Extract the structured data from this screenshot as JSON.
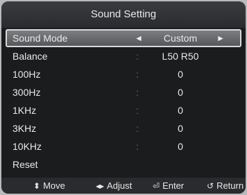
{
  "window": {
    "title": "Sound Setting"
  },
  "menu": {
    "items": [
      {
        "label": "Sound Mode",
        "separator": "",
        "value": "Custom",
        "left_arrow": "◄",
        "right_arrow": "►"
      },
      {
        "label": "Balance",
        "separator": ":",
        "value": "L50 R50"
      },
      {
        "label": "100Hz",
        "separator": ":",
        "value": "0"
      },
      {
        "label": "300Hz",
        "separator": ":",
        "value": "0"
      },
      {
        "label": "1KHz",
        "separator": ":",
        "value": "0"
      },
      {
        "label": "3KHz",
        "separator": ":",
        "value": "0"
      },
      {
        "label": "10KHz",
        "separator": ":",
        "value": "0"
      },
      {
        "label": "Reset",
        "separator": "",
        "value": ""
      }
    ]
  },
  "footer": {
    "move": {
      "icon": "⬍",
      "label": "Move"
    },
    "adjust": {
      "icon": "◂▸",
      "label": "Adjust"
    },
    "enter": {
      "icon": "⏎",
      "label": "Enter"
    },
    "return": {
      "icon": "↺",
      "label": "Return"
    }
  },
  "colors": {
    "background": "#1b1c1e",
    "highlight": "#6a6c70",
    "text": "#eaeaea",
    "frame_outer": "#b9babc"
  },
  "icons": {
    "move": "up-down-arrows-icon",
    "adjust": "left-right-arrows-icon",
    "enter": "enter-key-icon",
    "return": "return-icon"
  }
}
